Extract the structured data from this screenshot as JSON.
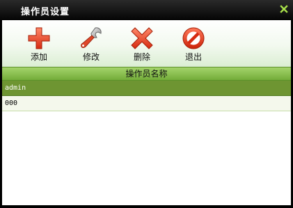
{
  "window": {
    "title": "操作员设置"
  },
  "toolbar": {
    "buttons": [
      {
        "label": "添加",
        "icon": "plus-icon"
      },
      {
        "label": "修改",
        "icon": "wrench-icon"
      },
      {
        "label": "删除",
        "icon": "x-icon"
      },
      {
        "label": "退出",
        "icon": "no-entry-icon"
      }
    ]
  },
  "list": {
    "header": "操作员名称",
    "rows": [
      {
        "name": "admin",
        "selected": true
      },
      {
        "name": "000",
        "selected": false
      }
    ]
  },
  "colors": {
    "titlebar": "#000000",
    "accent_green": "#73ac39",
    "selected_row": "#6e9532",
    "close_icon": "#a8e04a"
  }
}
